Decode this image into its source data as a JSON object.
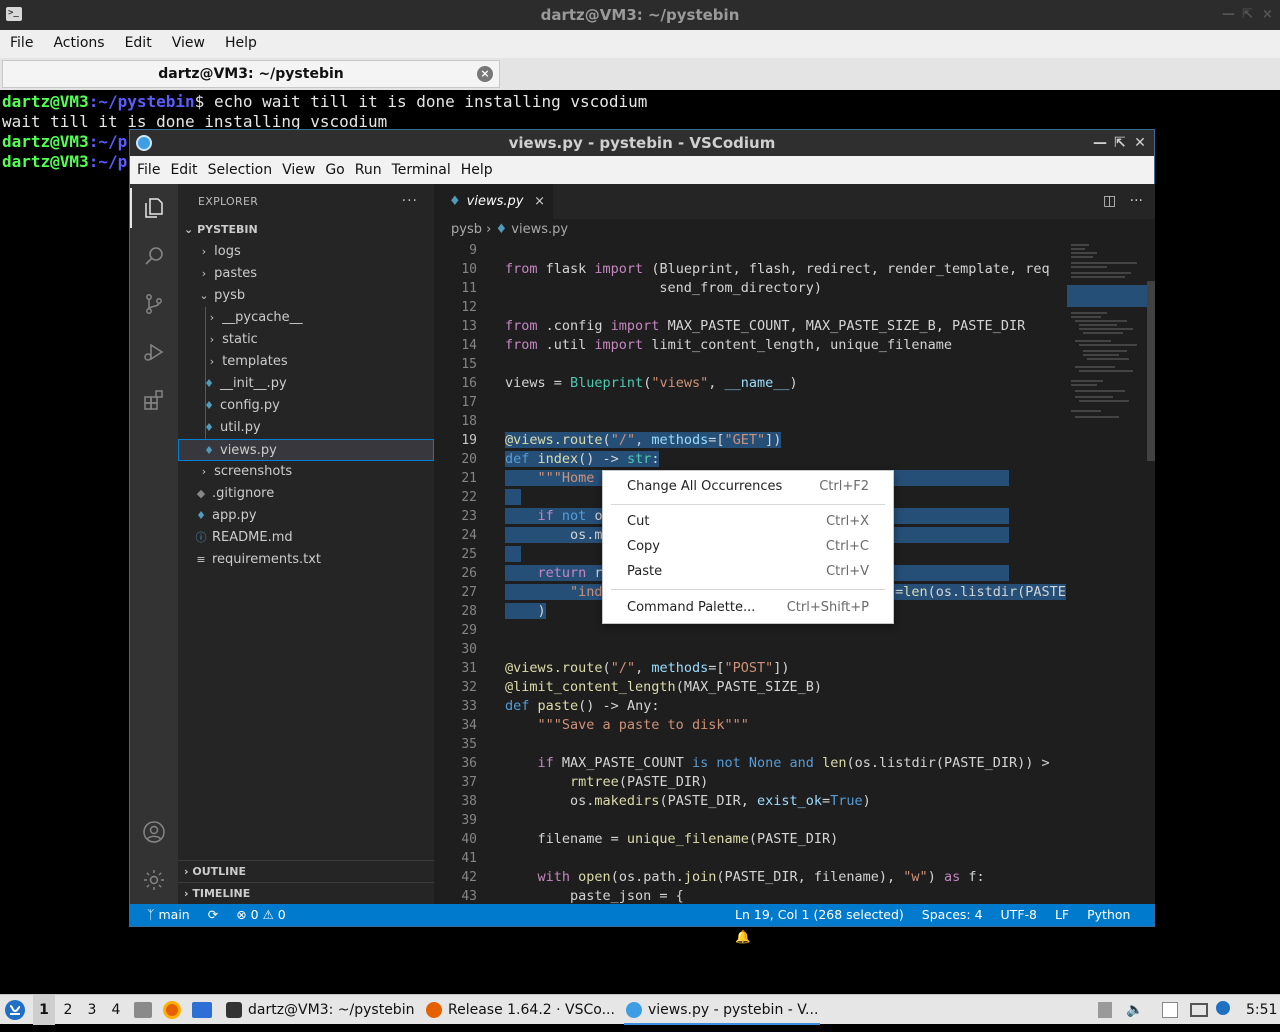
{
  "terminal": {
    "title": "dartz@VM3: ~/pystebin",
    "menu": [
      "File",
      "Actions",
      "Edit",
      "View",
      "Help"
    ],
    "tab_label": "dartz@VM3: ~/pystebin",
    "lines": [
      {
        "user": "dartz@VM3",
        "path": ":~/pystebin",
        "cmd": "$ echo wait till it is done installing vscodium"
      },
      {
        "out": "wait till it is done installing vscodium"
      },
      {
        "user": "dartz@VM3",
        "path": ":~/p",
        "cmd": ""
      },
      {
        "user": "dartz@VM3",
        "path": ":~/p",
        "cmd": ""
      }
    ]
  },
  "vscodium": {
    "title": "views.py - pystebin - VSCodium",
    "menu": [
      "File",
      "Edit",
      "Selection",
      "View",
      "Go",
      "Run",
      "Terminal",
      "Help"
    ],
    "explorer": {
      "header": "EXPLORER",
      "more": "···",
      "project": "PYSTEBIN",
      "outline": "OUTLINE",
      "timeline": "TIMELINE",
      "items": [
        "logs",
        "pastes",
        "pysb",
        "__pycache__",
        "static",
        "templates",
        "__init__.py",
        "config.py",
        "util.py",
        "views.py",
        "screenshots",
        ".gitignore",
        "app.py",
        "README.md",
        "requirements.txt"
      ]
    },
    "tab": {
      "label": "views.py",
      "close": "×"
    },
    "breadcrumb": {
      "folder": "pysb",
      "sep": "›",
      "file": "views.py"
    },
    "line_numbers": [
      "9",
      "10",
      "11",
      "12",
      "13",
      "14",
      "15",
      "16",
      "17",
      "18",
      "19",
      "20",
      "21",
      "22",
      "23",
      "24",
      "25",
      "26",
      "27",
      "28",
      "29",
      "30",
      "31",
      "32",
      "33",
      "34",
      "35",
      "36",
      "37",
      "38",
      "39",
      "40",
      "41",
      "42",
      "43"
    ],
    "status": {
      "branch": "main",
      "errors": "0",
      "warnings": "0",
      "position": "Ln 19, Col 1 (268 selected)",
      "spaces": "Spaces: 4",
      "encoding": "UTF-8",
      "eol": "LF",
      "language": "Python"
    }
  },
  "context_menu": {
    "items": [
      {
        "label": "Change All Occurrences",
        "key": "Ctrl+F2"
      },
      {
        "label": "Cut",
        "key": "Ctrl+X"
      },
      {
        "label": "Copy",
        "key": "Ctrl+C"
      },
      {
        "label": "Paste",
        "key": "Ctrl+V"
      },
      {
        "label": "Command Palette...",
        "key": "Ctrl+Shift+P"
      }
    ]
  },
  "taskbar": {
    "workspaces": [
      "1",
      "2",
      "3",
      "4"
    ],
    "apps": [
      {
        "label": "dartz@VM3: ~/pystebin"
      },
      {
        "label": "Release 1.64.2 · VSCo..."
      },
      {
        "label": "views.py - pystebin - V..."
      }
    ],
    "clock": "5:51"
  },
  "colors": {
    "accent": "#007acc",
    "selection": "#264f78",
    "prompt_user": "#54ff54",
    "prompt_path": "#5c5cff"
  }
}
